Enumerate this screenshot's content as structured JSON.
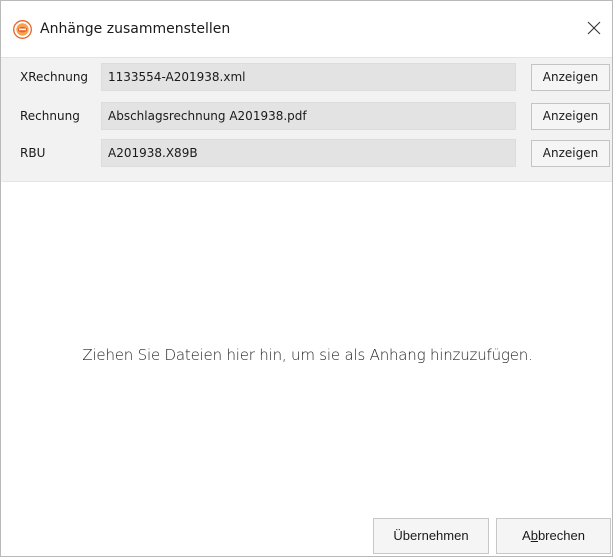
{
  "window": {
    "title": "Anhänge zusammenstellen",
    "app_icon": "app-logo-icon",
    "close_icon": "close-icon"
  },
  "attachments": [
    {
      "label": "XRechnung",
      "filename": "1133554-A201938.xml",
      "button_label": "Anzeigen"
    },
    {
      "label": "Rechnung",
      "filename": "Abschlagsrechnung A201938.pdf",
      "button_label": "Anzeigen"
    },
    {
      "label": "RBU",
      "filename": "A201938.X89B",
      "button_label": "Anzeigen"
    }
  ],
  "dropzone": {
    "hint": "Ziehen Sie Dateien hier hin, um sie als Anhang hinzuzufügen."
  },
  "footer": {
    "apply_label": "Übernehmen",
    "cancel_label_pre": "A",
    "cancel_label_mnemonic": "b",
    "cancel_label_post": "brechen"
  },
  "colors": {
    "section_bg": "#f2f2f2",
    "field_bg": "#e3e3e3",
    "icon_orange": "#e8632b"
  }
}
